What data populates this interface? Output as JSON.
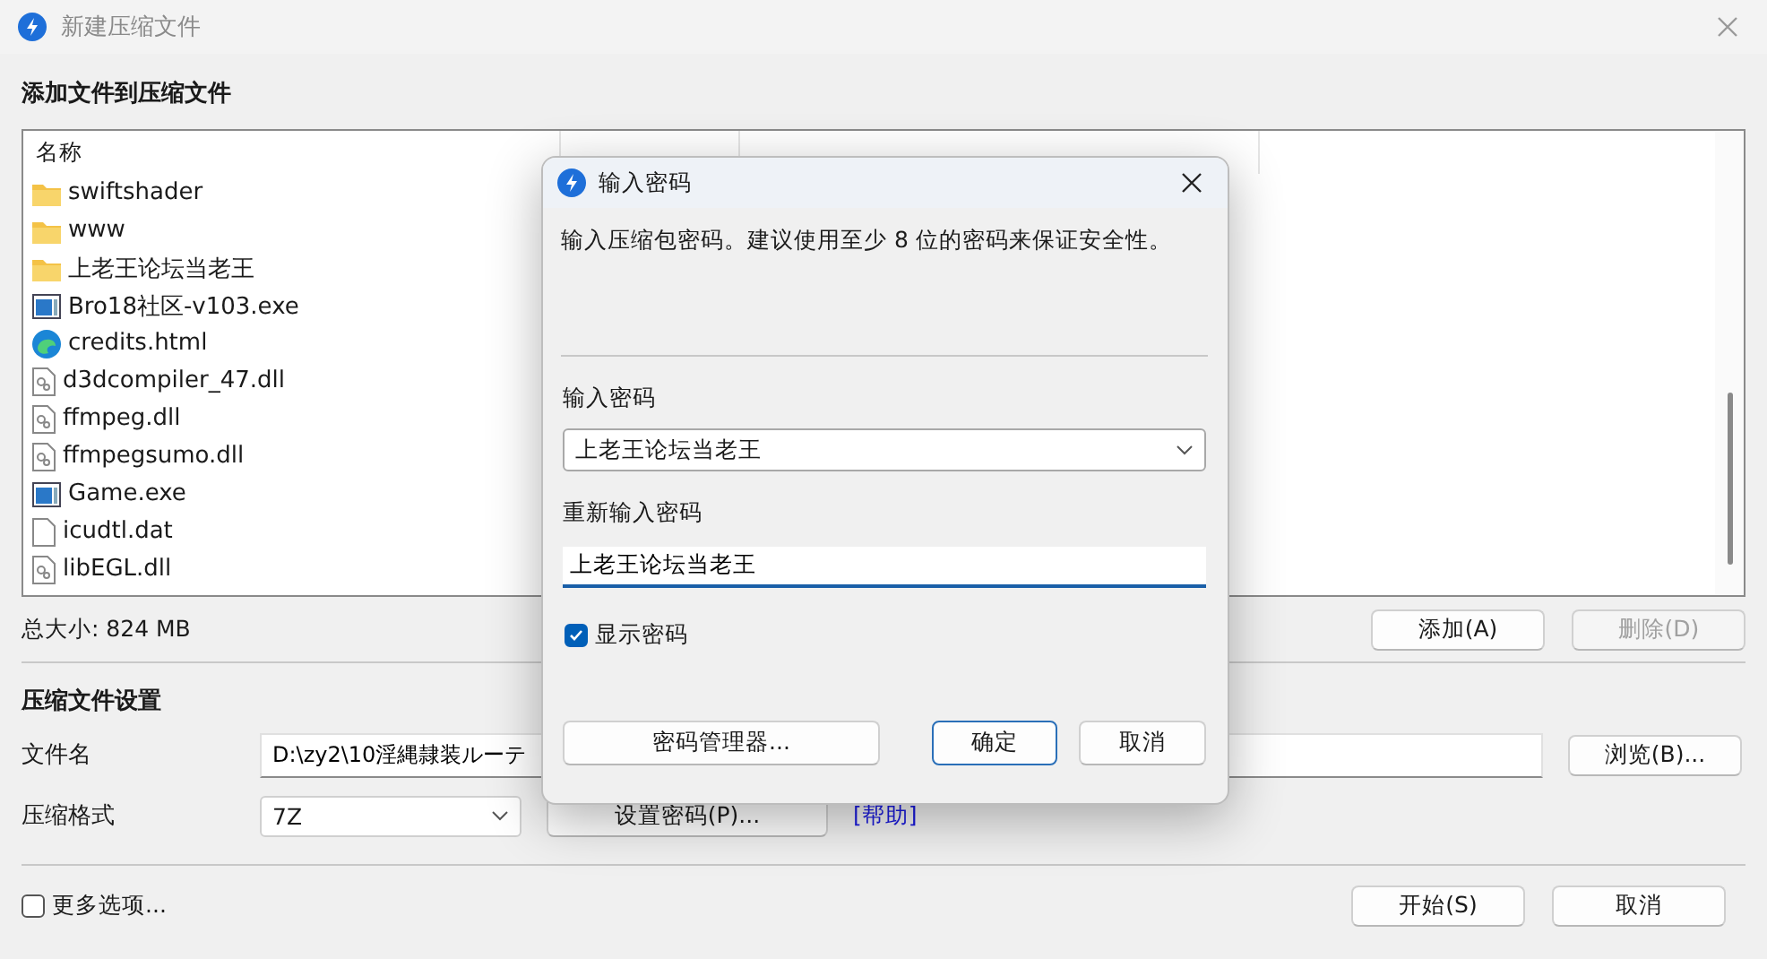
{
  "window": {
    "title": "新建压缩文件"
  },
  "add_section": {
    "title": "添加文件到压缩文件"
  },
  "file_list": {
    "columns": [
      "名称"
    ],
    "rows": [
      {
        "kind": "folder",
        "name": "swiftshader"
      },
      {
        "kind": "folder",
        "name": "www"
      },
      {
        "kind": "folder",
        "name": "上老王论坛当老王"
      },
      {
        "kind": "exe",
        "name": "Bro18社区-v103.exe"
      },
      {
        "kind": "web",
        "name": "credits.html"
      },
      {
        "kind": "dll",
        "name": "d3dcompiler_47.dll"
      },
      {
        "kind": "dll",
        "name": "ffmpeg.dll"
      },
      {
        "kind": "dll",
        "name": "ffmpegsumo.dll"
      },
      {
        "kind": "exe",
        "name": "Game.exe"
      },
      {
        "kind": "file",
        "name": "icudtl.dat"
      },
      {
        "kind": "dll",
        "name": "libEGL.dll"
      }
    ]
  },
  "total_size": "总大小: 824 MB",
  "list_buttons": [
    {
      "label": "添加(A)",
      "disabled": false
    },
    {
      "label": "删除(D)",
      "disabled": true
    }
  ],
  "settings": {
    "title": "压缩文件设置",
    "filename_label": "文件名",
    "filename": "D:\\zy2\\10淫縄隷装ルーテ",
    "browse_button": "浏览(B)...",
    "format_label": "压缩格式",
    "format": "7Z",
    "password_button": "设置密码(P)...",
    "help_link": "[帮助]"
  },
  "more_options": {
    "label": "更多选项...",
    "checked": false
  },
  "footer_buttons": [
    "开始(S)",
    "取消"
  ],
  "password_dialog": {
    "title": "输入密码",
    "message": "输入压缩包密码。建议使用至少 8 位的密码来保证安全性。",
    "password_label": "输入密码",
    "password": "上老王论坛当老王",
    "confirm_label": "重新输入密码",
    "confirm": "上老王论坛当老王",
    "show_password": {
      "label": "显示密码",
      "checked": true
    },
    "buttons": [
      {
        "label": "密码管理器...",
        "default": false
      },
      {
        "label": "确定",
        "default": true
      },
      {
        "label": "取消",
        "default": false
      }
    ]
  }
}
